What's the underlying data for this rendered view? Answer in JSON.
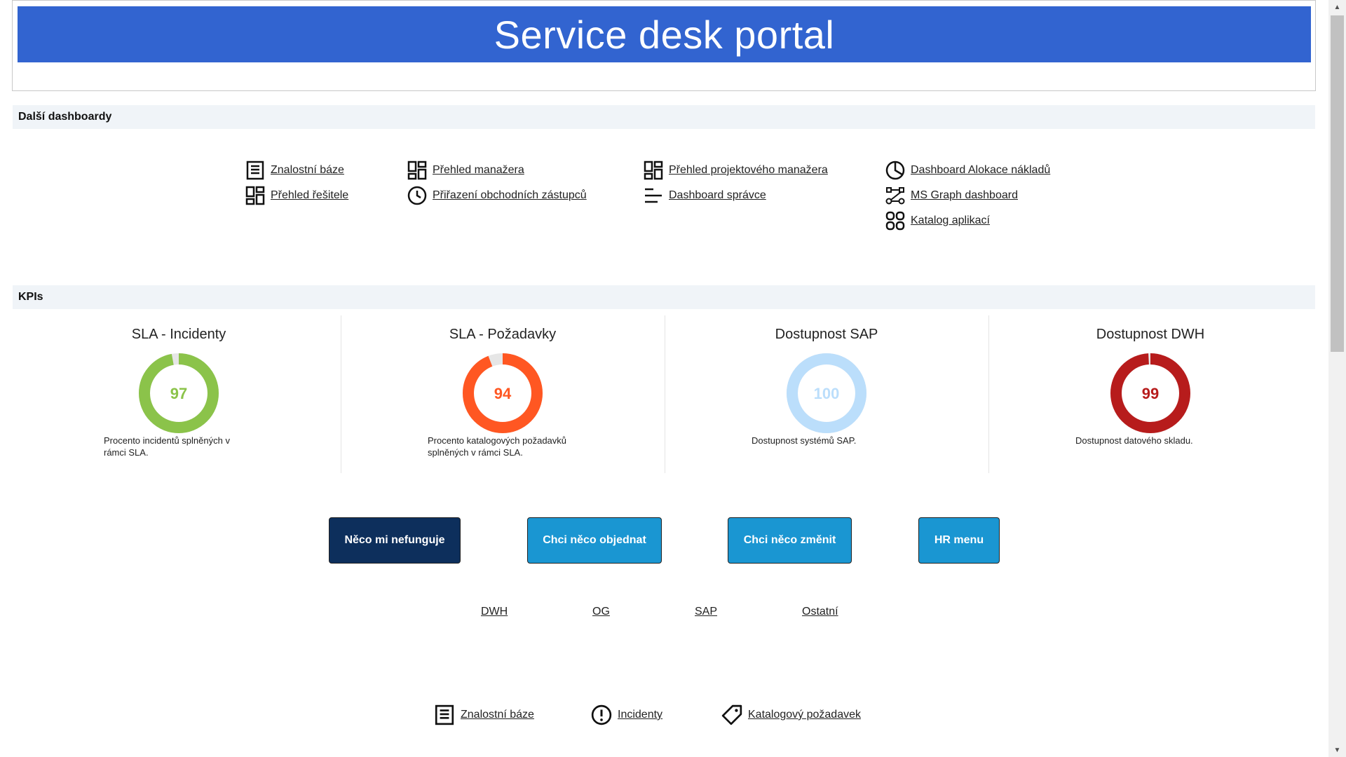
{
  "header": {
    "title": "Service desk portal"
  },
  "sections": {
    "dashboards_title": "Další dashboardy",
    "kpis_title": "KPIs"
  },
  "dashboards": [
    {
      "label": "Znalostní báze",
      "icon": "document-icon"
    },
    {
      "label": "Přehled řešitele",
      "icon": "dashboard-grid-icon"
    },
    {
      "label": "Přehled manažera",
      "icon": "dashboard-grid-icon"
    },
    {
      "label": "Přiřazení obchodních zástupců",
      "icon": "clock-icon"
    },
    {
      "label": "Přehled projektového manažera",
      "icon": "dashboard-grid-icon"
    },
    {
      "label": "Dashboard správce",
      "icon": "lines-icon"
    },
    {
      "label": "Dashboard Alokace nákladů",
      "icon": "pie-chart-icon"
    },
    {
      "label": "MS Graph dashboard",
      "icon": "graph-nodes-icon"
    },
    {
      "label": "Katalog aplikací",
      "icon": "apps-icon"
    }
  ],
  "kpis": [
    {
      "title": "SLA - Incidenty",
      "value": 97,
      "display": "97",
      "percent": 97,
      "color": "#8bc34a",
      "desc_line1": "Procento incidentů splněných v",
      "desc_line2": "rámci SLA."
    },
    {
      "title": "SLA - Požadavky",
      "value": 94,
      "display": "94",
      "percent": 94,
      "color": "#ff5722",
      "desc_line1": "Procento katalogových požadavků",
      "desc_line2": "splněných v rámci SLA."
    },
    {
      "title": "Dostupnost SAP",
      "value": 100,
      "display": "100",
      "percent": 100,
      "color": "#bbdefb",
      "desc_line1": "Dostupnost systémů SAP.",
      "desc_line2": ""
    },
    {
      "title": "Dostupnost DWH",
      "value": 99,
      "display": "99",
      "percent": 99,
      "color": "#b71c1c",
      "desc_line1": "Dostupnost datového skladu.",
      "desc_line2": ""
    }
  ],
  "actions": [
    {
      "label": "Něco mi nefunguje",
      "color": "#0d2f5c"
    },
    {
      "label": "Chci něco objednat",
      "color": "#1a96d2"
    },
    {
      "label": "Chci něco změnit",
      "color": "#1a96d2"
    },
    {
      "label": "HR menu",
      "color": "#1a96d2"
    }
  ],
  "sublinks": [
    "DWH",
    "OG",
    "SAP",
    "Ostatní"
  ],
  "bottom_links": [
    {
      "label": "Znalostní báze",
      "icon": "document-icon"
    },
    {
      "label": "Incidenty",
      "icon": "alert-circle-icon"
    },
    {
      "label": "Katalogový požadavek",
      "icon": "tag-icon"
    }
  ],
  "track_color": "#e6e6e6"
}
